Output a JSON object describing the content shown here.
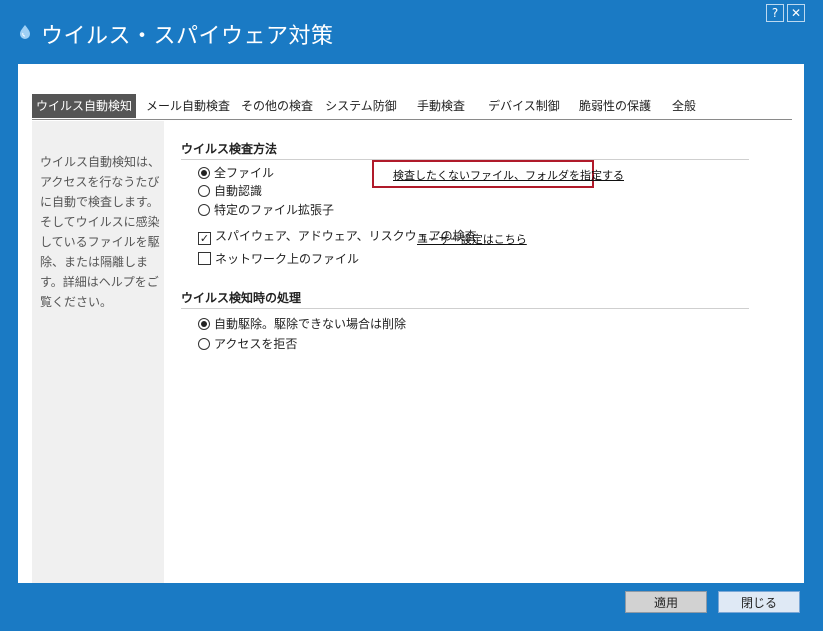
{
  "window": {
    "title": "ウイルス・スパイウェア対策",
    "help_label": "?",
    "close_label": "✕"
  },
  "tabs": [
    {
      "label": "ウイルス自動検知",
      "active": true
    },
    {
      "label": "メール自動検査"
    },
    {
      "label": "その他の検査"
    },
    {
      "label": "システム防御"
    },
    {
      "label": "手動検査"
    },
    {
      "label": "デバイス制御"
    },
    {
      "label": "脆弱性の保護"
    },
    {
      "label": "全般"
    }
  ],
  "sidebar": {
    "description": "ウイルス自動検知は、アクセスを行なうたびに自動で検査します。そしてウイルスに感染しているファイルを駆除、または隔離します。詳細はヘルプをご覧ください。"
  },
  "scan_method": {
    "title": "ウイルス検査方法",
    "options": [
      {
        "label": "全ファイル",
        "checked": true
      },
      {
        "label": "自動認識",
        "checked": false
      },
      {
        "label": "特定のファイル拡張子",
        "checked": false
      }
    ],
    "exclude_link": "検査したくないファイル、フォルダを指定する",
    "spyware_check": {
      "label": "スパイウェア、アドウェア、リスクウェアの検査",
      "checked": true
    },
    "user_settings_link": "ユーザー設定はこちら",
    "network_check": {
      "label": "ネットワーク上のファイル",
      "checked": false
    }
  },
  "detection_action": {
    "title": "ウイルス検知時の処理",
    "options": [
      {
        "label": "自動駆除。駆除できない場合は削除",
        "checked": true
      },
      {
        "label": "アクセスを拒否",
        "checked": false
      }
    ]
  },
  "footer": {
    "apply_label": "適用",
    "close_label": "閉じる"
  },
  "colors": {
    "frame": "#1a7ac4",
    "active_tab": "#555555",
    "highlight": "#b01a2a"
  }
}
